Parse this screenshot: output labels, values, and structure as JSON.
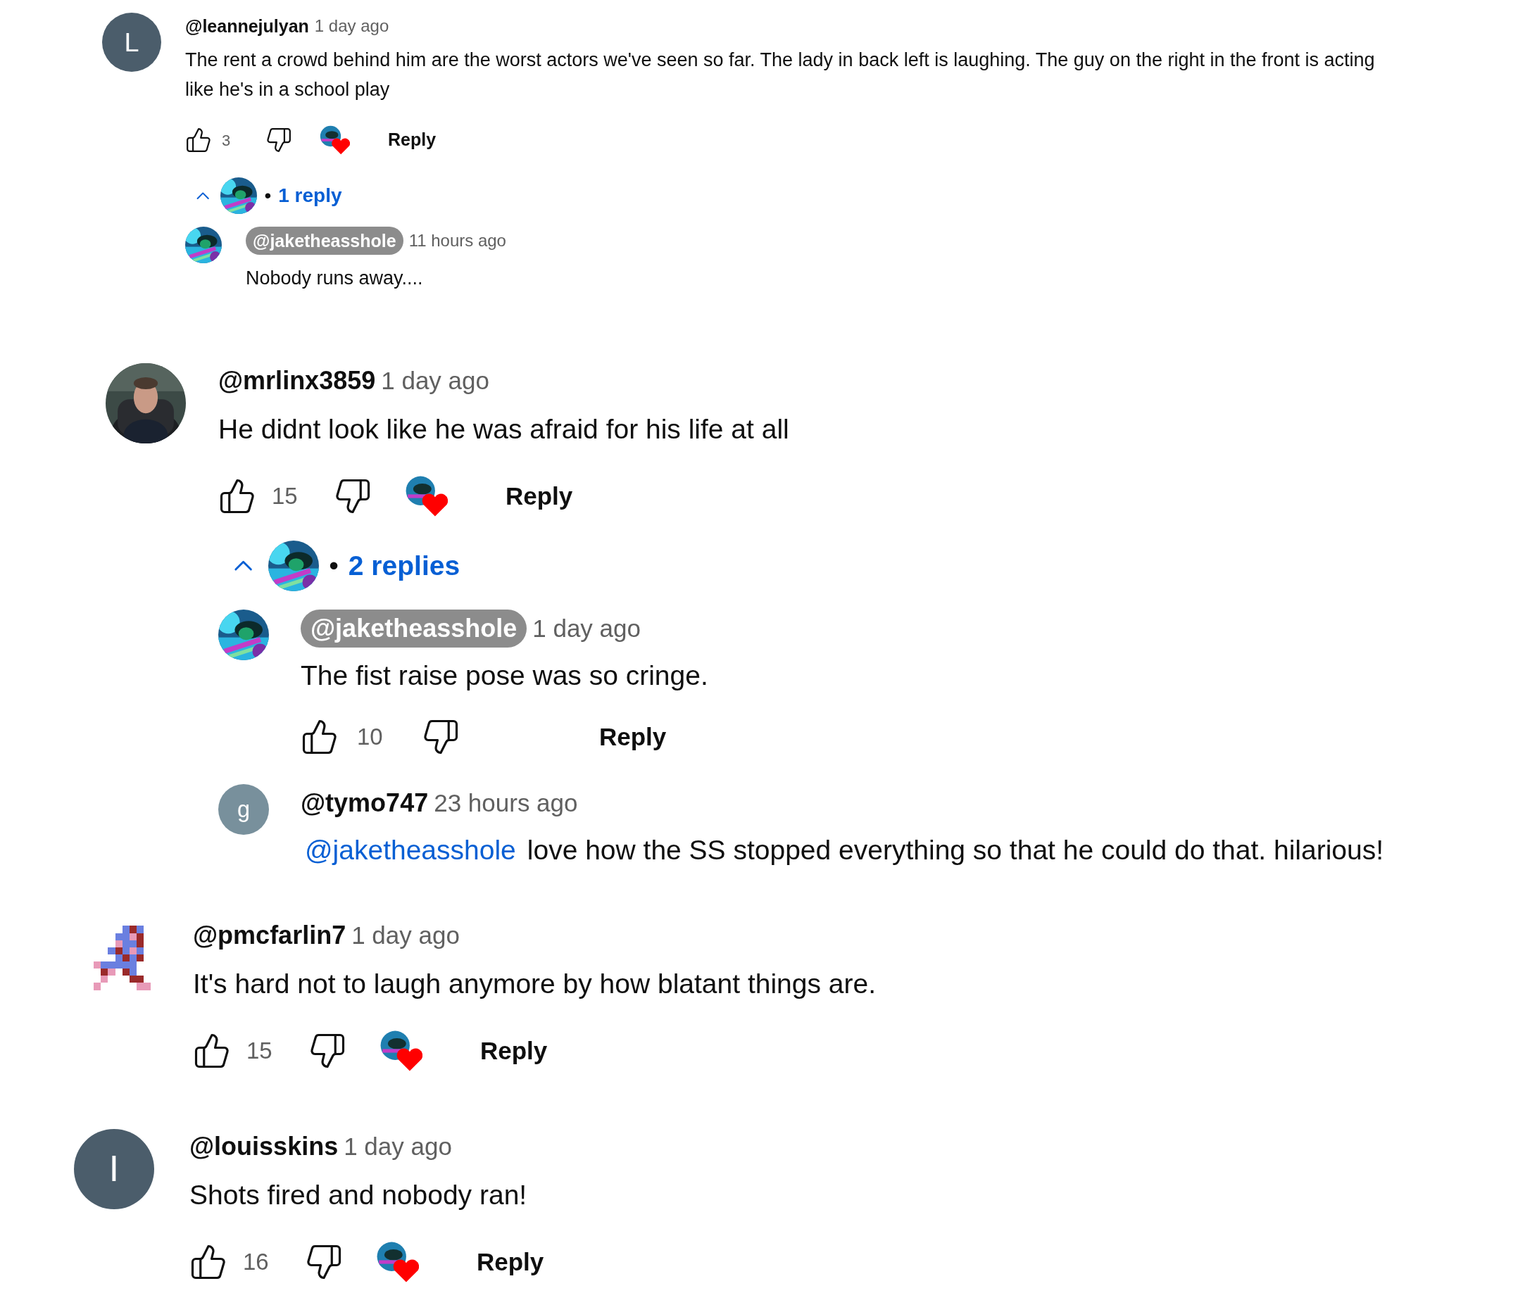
{
  "comments": [
    {
      "avatar": {
        "kind": "letter",
        "letter": "L",
        "color": "#4b5d6b"
      },
      "author": "@leannejulyan",
      "time": "1 day ago",
      "text": "The rent a crowd behind him are the worst actors we've seen so far. The lady in back left is laughing. The guy on the right in the front is acting like he's in a school play",
      "likes": "3",
      "hearted": true,
      "reply_label": "Reply",
      "replies_toggle": {
        "expanded": true,
        "separator": "•",
        "label": "1 reply"
      },
      "replies": [
        {
          "avatar": {
            "kind": "art"
          },
          "author": "@jaketheasshole",
          "creator": true,
          "time": "11 hours ago",
          "text": "Nobody runs away...."
        }
      ]
    },
    {
      "author": "@mrlinx3859",
      "time": "1 day ago",
      "text": "He didnt look like he was afraid for his life at all",
      "likes": "15",
      "hearted": true,
      "reply_label": "Reply",
      "replies_toggle": {
        "expanded": true,
        "separator": "•",
        "label": "2 replies"
      },
      "replies": [
        {
          "avatar": {
            "kind": "art"
          },
          "author": "@jaketheasshole",
          "creator": true,
          "time": "1 day ago",
          "text": "The fist raise pose was so cringe.",
          "likes": "10",
          "hearted": false,
          "reply_label": "Reply"
        },
        {
          "avatar": {
            "kind": "letter",
            "letter": "g",
            "color": "#78909c"
          },
          "author": "@tymo747",
          "creator": false,
          "time": "23 hours ago",
          "mention": "@jaketheasshole",
          "text": "love how the SS stopped everything so that he could do that. hilarious!"
        }
      ]
    },
    {
      "avatar": {
        "kind": "sprite"
      },
      "author": "@pmcfarlin7",
      "time": "1 day ago",
      "text": "It's hard not to laugh anymore by how blatant things are.",
      "likes": "15",
      "hearted": true,
      "reply_label": "Reply"
    },
    {
      "avatar": {
        "kind": "letter",
        "letter": "I",
        "color": "#4b5d6b"
      },
      "author": "@louisskins",
      "time": "1 day ago",
      "text": "Shots fired and nobody ran!",
      "likes": "16",
      "hearted": true,
      "reply_label": "Reply"
    }
  ]
}
